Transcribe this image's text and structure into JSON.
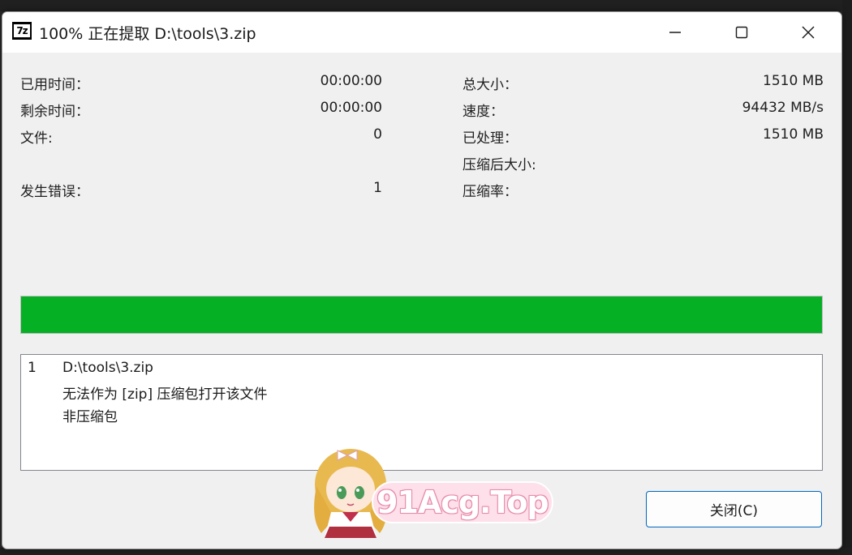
{
  "window": {
    "icon_label": "7z",
    "title": "100% 正在提取 D:\\tools\\3.zip"
  },
  "stats_left": [
    {
      "label": "已用时间：",
      "value": "00:00:00"
    },
    {
      "label": "剩余时间：",
      "value": "00:00:00"
    },
    {
      "label": "文件:",
      "value": "0"
    },
    {
      "label": "发生错误：",
      "value": "1"
    }
  ],
  "stats_right": [
    {
      "label": "总大小：",
      "value": "1510 MB"
    },
    {
      "label": "速度：",
      "value": "94432 MB/s"
    },
    {
      "label": "已处理：",
      "value": "1510 MB"
    },
    {
      "label": "压缩后大小:",
      "value": ""
    },
    {
      "label": "压缩率：",
      "value": ""
    }
  ],
  "progress": {
    "percent": 100,
    "color": "#06b025"
  },
  "log": {
    "number": "1",
    "lines": [
      "D:\\tools\\3.zip",
      "无法作为 [zip] 压缩包打开该文件",
      "非压缩包"
    ]
  },
  "close_button": "关闭(C)",
  "watermark": {
    "text": "91Acg.Top"
  },
  "icons": [
    "minimize-icon",
    "maximize-icon",
    "close-icon",
    "7zip-app-icon"
  ]
}
